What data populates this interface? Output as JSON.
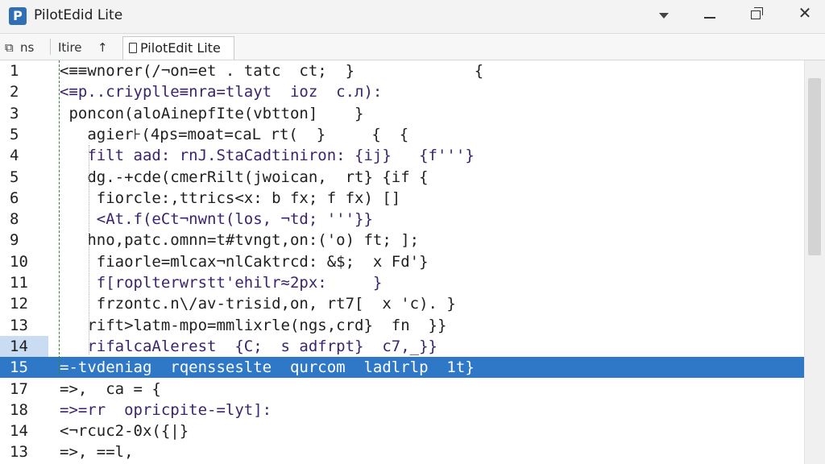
{
  "window": {
    "title": "PilotEdid Lite",
    "app_icon_letter": "P",
    "close_glyph": "✕"
  },
  "toolbar": {
    "icon_glyph": "⧉",
    "item1": "ns",
    "item2": "Itire",
    "up_glyph": "↑",
    "tab_label": "PilotEdit Lite"
  },
  "editor": {
    "current_line_index": 14,
    "lines": [
      {
        "num": "1",
        "text": "<≡≡wnorer(/¬on=et . tatc  ct;  }             {"
      },
      {
        "num": "2",
        "text": "<≡p..criyplle≡nra=tlayt  ioz  c.л):"
      },
      {
        "num": "3",
        "text": " poncon(aloAinepfIte(vbtton]    }"
      },
      {
        "num": "5",
        "text": "   agier⊦(4ps=moat=caL rt(  }     {  {"
      },
      {
        "num": "4",
        "text": "   filt aad: rnJ.StaCadtiniron: {ij}   {f'''}"
      },
      {
        "num": "5",
        "text": "   dg.-+cde(cmerRilt(jwoican,  rt} {if {"
      },
      {
        "num": "6",
        "text": "    fiorcle:,ttrics<x: b fx; f fx) []"
      },
      {
        "num": "8",
        "text": "    <At.f(eCt¬nwnt(los, ¬td; '''}}"
      },
      {
        "num": "9",
        "text": "   hno,patc.omnn=t#tvngt,on:('o) ft; ];"
      },
      {
        "num": "10",
        "text": "    fiaorle=mlcax¬nlCaktrcd: &$;  x Fd'}"
      },
      {
        "num": "11",
        "text": "    f[roplterwrstt'ehilr≈2px:     }"
      },
      {
        "num": "12",
        "text": "    frzontc.n\\/av-trisid,on, rt7[  x 'c). }"
      },
      {
        "num": "13",
        "text": "   rift>latm-mpo=mmlixrle(ngs,crd}  fn  }}"
      },
      {
        "num": "14",
        "text": "   rifalcaAlerest  {C;  s adfrpt}  c7,_}}"
      },
      {
        "num": "15",
        "text": "=-tvdeniag  rqensseslte  qurcom  ladlrlp  1t}"
      },
      {
        "num": "17",
        "text": "=>,  ca = {"
      },
      {
        "num": "18",
        "text": "=>=rr  opricpite-=lyt]:"
      },
      {
        "num": "14",
        "text": "<¬rcuc2-0x({|}"
      },
      {
        "num": "13",
        "text": "=>, ==l,"
      }
    ]
  },
  "colors": {
    "selection": "#2e78c7",
    "selection_dim": "#c9dcf2",
    "code_text": "#1f1f1f",
    "keyword": "#6b3fa6"
  }
}
